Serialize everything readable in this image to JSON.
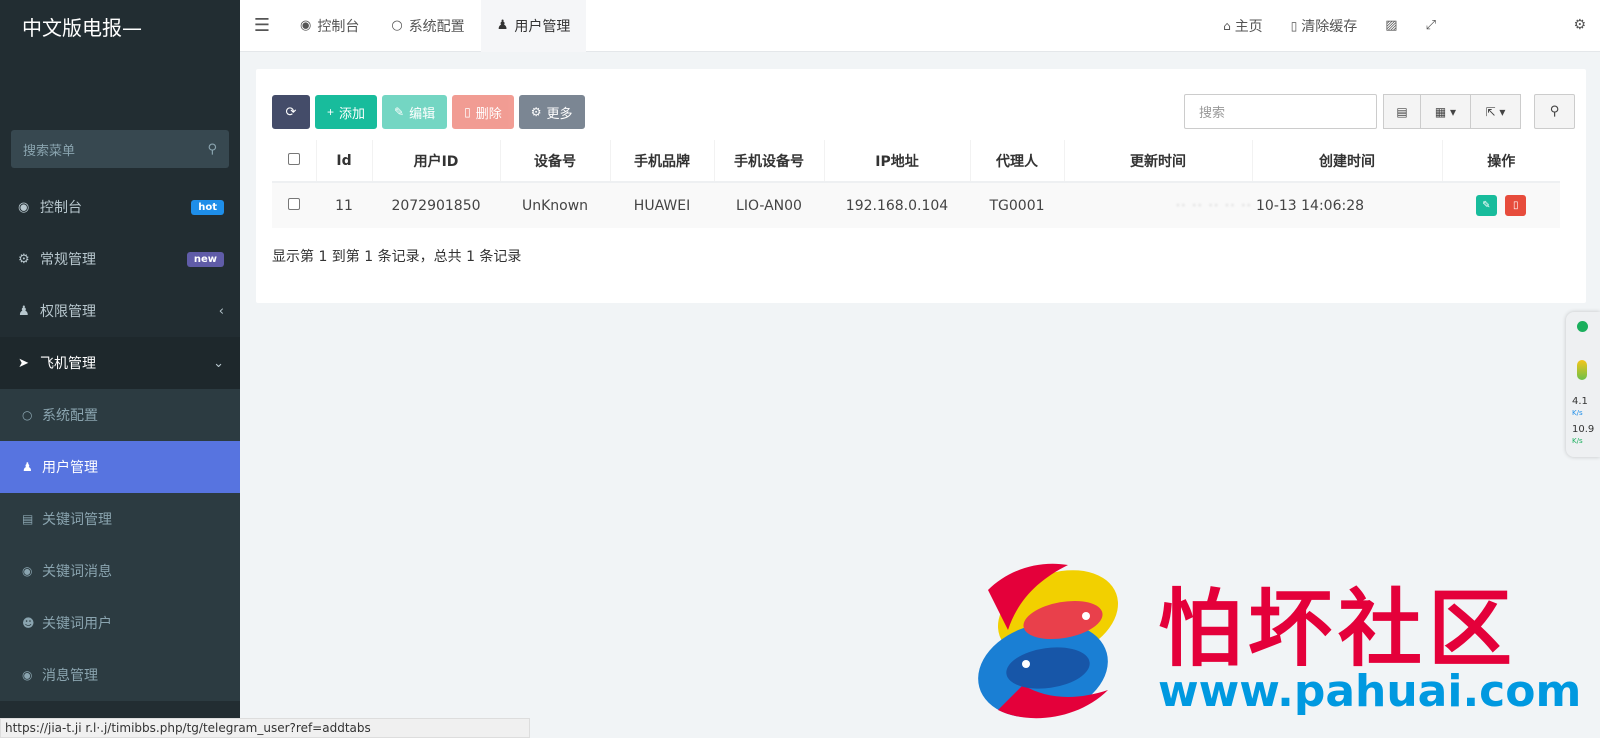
{
  "sidebar": {
    "brand": "中文版电报—",
    "search_placeholder": "搜索菜单",
    "items": [
      {
        "label": "控制台",
        "badge": "hot"
      },
      {
        "label": "常规管理",
        "badge": "new"
      },
      {
        "label": "权限管理"
      },
      {
        "label": "飞机管理"
      }
    ],
    "subitems": [
      {
        "label": "系统配置"
      },
      {
        "label": "用户管理"
      },
      {
        "label": "关键词管理"
      },
      {
        "label": "关键词消息"
      },
      {
        "label": "关键词用户"
      },
      {
        "label": "消息管理"
      }
    ]
  },
  "topbar": {
    "tabs": [
      {
        "label": "控制台"
      },
      {
        "label": "系统配置"
      },
      {
        "label": "用户管理"
      }
    ],
    "home_label": "主页",
    "clear_cache_label": "清除缓存"
  },
  "toolbar": {
    "add_label": "添加",
    "edit_label": "编辑",
    "delete_label": "删除",
    "more_label": "更多",
    "search_placeholder": "搜索"
  },
  "table": {
    "headers": [
      "Id",
      "用户ID",
      "设备号",
      "手机品牌",
      "手机设备号",
      "IP地址",
      "代理人",
      "更新时间",
      "创建时间",
      "操作"
    ],
    "rows": [
      {
        "id": "11",
        "user_id": "2072901850",
        "device_no": "UnKnown",
        "brand": "HUAWEI",
        "model": "LIO-AN00",
        "ip": "192.168.0.104",
        "agent": "TG0001",
        "updated": "·· ·· ·· ·· ··",
        "created": "10-13 14:06:28"
      }
    ]
  },
  "pager_info": "显示第 1 到第 1 条记录，总共 1 条记录",
  "float_widget": {
    "up_value": "4.1",
    "up_unit": "K/s",
    "down_value": "10.9",
    "down_unit": "K/s"
  },
  "status_url": "https://jia-t.ji  r.l·.j/timibbs.php/tg/telegram_user?ref=addtabs",
  "watermark": {
    "title": "怕坏社区",
    "url": "www.pahuai.com"
  },
  "colors": {
    "sidebar_bg": "#222d32",
    "active": "#5774e0",
    "success": "#18bc9c",
    "danger": "#e74c3c"
  }
}
